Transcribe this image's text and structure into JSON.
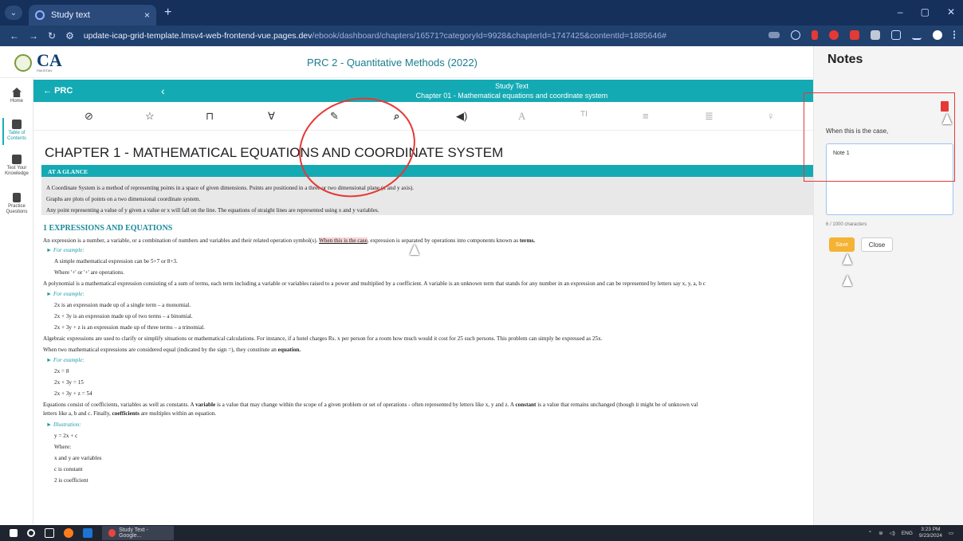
{
  "browser": {
    "tab_title": "Study text",
    "tab_close": "×",
    "new_tab": "+",
    "url_main": "update-icap-grid-template.lmsv4-web-frontend-vue.pages.dev",
    "url_path": "/ebook/dashboard/chapters/16571?categoryId=9928&chapterId=1747425&contentId=1885646#",
    "win_min": "–",
    "win_max": "▢",
    "win_close": "✕"
  },
  "header": {
    "logo_text": "CA",
    "logo_subtext": "PAKISTAN",
    "doc_title": "PRC 2 - Quantitative Methods (2022)"
  },
  "sidebar": {
    "items": [
      {
        "label": "Home"
      },
      {
        "label": "Table of Contents"
      },
      {
        "label": "Test Your Knowledge"
      },
      {
        "label": "Practice Questions"
      }
    ]
  },
  "topbar": {
    "back_label": "PRC",
    "section": "Study Text",
    "chapter": "Chapter 01 - Mathematical equations and coordinate system"
  },
  "content": {
    "chapter_title": "CHAPTER 1 - MATHEMATICAL EQUATIONS AND COORDINATE SYSTEM",
    "glance_heading": "AT A GLANCE",
    "glance": [
      "A Coordinate System is a method of representing points in a space of given dimensions. Points are positioned in a three or two dimensional plane (x and y axis).",
      "Graphs are plots of points on a two dimensional coordinate system.",
      "Any point representing a value of y given a value or x will fall on the line. The equations of straight lines are represented using x and y variables."
    ],
    "section_title": "1   EXPRESSIONS AND EQUATIONS",
    "p1_a": "An expression is a number, a variable, or a combination of numbers and variables and their related operation symbol(s).",
    "p1_highlight": "When this is the case",
    "p1_b": ", expression is separated by operations into components known as",
    "p1_bold": "terms.",
    "for_example": "►  For example:",
    "ex1": [
      "A simple mathematical expression can be 5+7 or 8+3.",
      "Where '+' or '+' are operations."
    ],
    "p2": "A polynomial is a mathematical expression consisting of a sum of terms, each term including a variable or variables raised to a power and multiplied by a coefficient. A variable is an unknown term that stands for any number in an expression and can be represented by letters say x, y, a, b c",
    "ex2": [
      "2x is an expression made up of a single term – a monomial.",
      "2x + 3y is an expression made up of two terms – a binomial.",
      "2x + 3y + z is an expression made up of three terms – a trinomial."
    ],
    "p3": "Algebraic expressions are used to clarify or simplify situations or mathematical calculations. For instance, if a hotel charges Rs. x per person for a room how much would it cost for 25 such persons. This problem can simply be expressed as 25x.",
    "p4_a": "When two mathematical expressions are considered equal (indicated by the sign =), they constitute an",
    "p4_bold": "equation.",
    "ex3": [
      "2x = 8",
      "2x + 3y = 15",
      "2x + 3y + z = 54"
    ],
    "p5_a": "Equations consist of coefficients, variables as well as constants. A",
    "p5_b1": "variable",
    "p5_c": "is a value that may change within the scope of a given problem or set of operations - often represented by letters like x, y and z. A",
    "p5_b2": "constant",
    "p5_d": "is a value that remains unchanged (though it might be of unknown val",
    "p5_e1": "letters like a, b and c. Finally,",
    "p5_b3": "coefficients",
    "p5_e2": "are multiples within an equation.",
    "illustration": "►  Illustration:",
    "ill": [
      "y = 2x + c",
      "Where:",
      "x and y are variables",
      "c is constant",
      "2 is coefficient"
    ]
  },
  "notes": {
    "title": "Notes",
    "quote": "When this is the case,",
    "note_value": "Note 1",
    "counter": "6 / 1000 characters",
    "save": "Save",
    "close": "Close"
  },
  "taskbar": {
    "app": "Study Text - Google...",
    "lang": "ENG",
    "time": "3:23 PM",
    "date": "9/23/2024"
  }
}
